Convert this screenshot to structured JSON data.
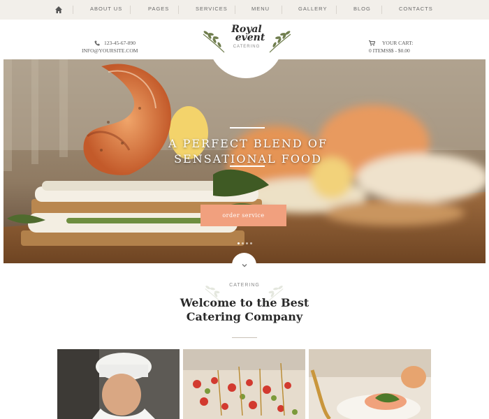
{
  "nav": {
    "items": [
      "ABOUT US",
      "PAGES",
      "SERVICES",
      "MENU",
      "GALLERY",
      "BLOG",
      "CONTACTS"
    ]
  },
  "contact": {
    "phone": "123-45-67-890",
    "email": "INFO@YOURSITE.COM"
  },
  "logo": {
    "title_line1": "Royal",
    "title_line2": "event",
    "subtitle": "CATERING"
  },
  "cart": {
    "label": "YOUR CART:",
    "summary": "0 ITEMS$$ - $0.00"
  },
  "hero": {
    "title_line1": "A PERFECT BLEND OF",
    "title_line2": "SENSATIONAL FOOD",
    "button_label": "order service",
    "slides": 4,
    "active_slide": 1
  },
  "welcome": {
    "eyebrow": "CATERING",
    "title_line1": "Welcome to the Best",
    "title_line2": "Catering Company"
  },
  "colors": {
    "accent": "#f1a07e",
    "nav_bg": "#f2efea",
    "leaf_green": "#6f7d4d"
  },
  "icons": [
    "home-icon",
    "phone-icon",
    "mail-icon",
    "cart-icon",
    "leaf-icon",
    "chevron-down-icon"
  ]
}
